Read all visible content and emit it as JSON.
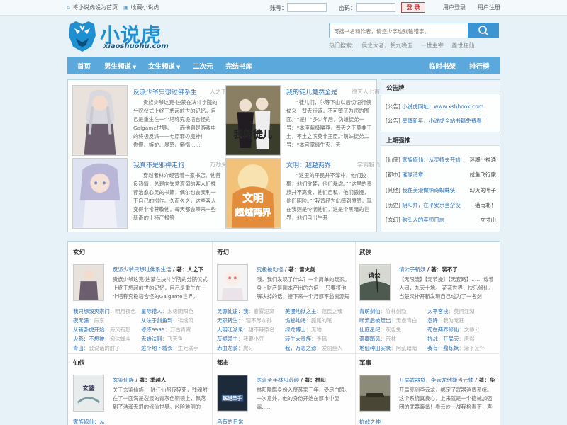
{
  "topbar": {
    "set_home": "将小说虎设为首页",
    "bookmark": "收藏小说虎",
    "account_label": "账号：",
    "password_label": "密码：",
    "login_button": "登 录",
    "user_login": "用户登录",
    "user_register": "用户注册"
  },
  "header": {
    "logo_text": "小说虎",
    "logo_sub": "xiaoshuohu.com",
    "search_placeholder": "可搜书名和作者，请您少字也别输错字。",
    "hot_label": "热门搜索:",
    "hot_terms": [
      "侯之大者，朝九晚五",
      "一世主宰",
      "盖世狂仙"
    ]
  },
  "nav": {
    "items": [
      "首页",
      "男生频道",
      "女生频道",
      "二次元",
      "完结书库"
    ],
    "right_items": [
      "临时书架",
      "排行榜"
    ]
  },
  "featured": [
    {
      "title": "反派少爷只想过佛系生",
      "author": "人之下",
      "desc": "贵族少爷这克·迪蒙在决斗学院的分院仪式上终于想起前世的记忆，自己是重生在一个塔称究极培合怪的Galgame世界。　　而他则是游戏中的终极反派——七原罪の魔神！　　傲慢、嫉妒、暴怒、懒惰……"
    },
    {
      "title": "我的徒儿竟然全是",
      "author": "徐天人七首",
      "desc": "“徒儿们，尔等下山以后切记行侠仗义，替天行道，不可堕了为师的围面。”“是！”多少年后，伪娘徒弟一号：“本座紫极魔尊，普天之下莫非王土，率土之滨莫非王臣。”萌妹徒弟二号：“本宫掌缘生灭，天"
    },
    {
      "title": "我真不是邪神走狗",
      "author": "万劫火",
      "desc": "穿越者林介经营着一家书店。他善良热情，总是向失意潦倒的客人们推荐治愈心灵的书籍，偶尔也会安利一下自己的拙作。久而久之，这些客人变得非常尊敬他，每天都会带来一些新奇的土特产报答"
    },
    {
      "title": "文明：超越两界",
      "author": "学霸毅飞",
      "desc": "“这里的平民并不淳朴，他们狡猾，他们贪婪，他们暴虐。”“这里的贵族并不高贵，他们自私，他们傲慢，他们阴险。”“我曾经为此感到愤怒，现在我则是怜悯他们，这是个黑暗的世界，他们自出生开"
    }
  ],
  "notice": {
    "title": "公告牌",
    "rows": [
      {
        "tag": "[公告]",
        "text": "小说虎网址：www.xshhook.com"
      },
      {
        "tag": "[公告]",
        "text": "星辉新年，小说虎全站书籍免费看！"
      }
    ]
  },
  "recommend": {
    "title": "上期强推",
    "rows": [
      {
        "tag": "[仙侠]",
        "book": "家族修仙：从灵植夫开始",
        "author": "迷糊小神通"
      },
      {
        "tag": "[都市]",
        "book": "璀璨诗章",
        "author": "咸鱼飞行家"
      },
      {
        "tag": "[其他]",
        "book": "我在美漫做惊奇蜘蛛侠",
        "author": "幻灭的叶子"
      },
      {
        "tag": "[历史]",
        "book": "阴阳师，在平安京当杂役",
        "author": "猫南北！"
      },
      {
        "tag": "[玄幻]",
        "book": "狗头人的巫师日志",
        "author": "立寸山"
      }
    ]
  },
  "categories": [
    {
      "name": "玄幻",
      "book": "反派少爷只想过佛系生活",
      "author_label": "/ 著：人之下",
      "desc": "贵族少爷这克·迪蒙在决斗学院的分院仪式上终于想起前世的记忆，自己是重生在一个塔称究极培合怪的Galgame世界。",
      "list": [
        [
          "我只想毁灭宗门",
          "明月夜色",
          "星际猎人",
          "太极阴阳色"
        ],
        [
          "夜无疆",
          "辰东",
          "从法于剑鱼到",
          "锦绣风"
        ],
        [
          "从斩卧虎开始",
          "海风有影",
          "修炼9999",
          "万古青霄"
        ],
        [
          "火影：不想被",
          "泡沫蜂斗",
          "无始法则",
          "飞天鱼"
        ],
        [
          "青山",
          "会说话的肘子",
          "这个地下城长",
          "生死满手"
        ]
      ]
    },
    {
      "name": "奇幻",
      "book": "究极被动怪",
      "author_label": "/ 著：雷火剑",
      "desc": "哦，我们发现了什么？一个简单的玩家。身上财产是副本产出的六倍！ 只要将他解决掉的话，接下来一个月都不愁资源短",
      "list": [
        [
          "灵源仙途：我",
          "春雾泥窝",
          "美漫地狱之主",
          "范氏之魂"
        ],
        [
          "无职转生：",
          "理不尽な孙",
          "诡秘地海",
          "狐尾的笔"
        ],
        [
          "大明江湖录",
          "甜不辣原名",
          "绿龙博士",
          "无物"
        ],
        [
          "灰烬领主",
          "我要小豆",
          "转生大贵族",
          "予稿"
        ],
        [
          "赤血龙骑",
          "虎牙",
          "我，万恶之源",
          "爱丽丝人"
        ]
      ]
    },
    {
      "name": "武侠",
      "book": "请公子斩妖",
      "author_label": "/ 著：裴不了",
      "desc": "【无限流】【无节操】【无套路】…… 载着人间，九天十地。 花花世界，快乐修仙。 当楚梁神开新发现自己成为了一名剑",
      "list": [
        [
          "青萌剑仙",
          "竹林剑隐",
          "太平客栈",
          "莫问江湖"
        ],
        [
          "断流后被赶出",
          "无虑青白",
          "忽降",
          "我为宠狂"
        ],
        [
          "仙庭星纪",
          "灰色兔",
          "苟在两界修仙",
          "文静公"
        ],
        [
          "漫卿踏风",
          "荒林",
          "抗战：开局天",
          "唐然"
        ],
        [
          "地仙种田实录",
          "阿乱暗暗",
          "我有一鼎炼妖",
          "渐下茫怀"
        ]
      ]
    },
    {
      "name": "仙侠",
      "book": "玄鉴仙族",
      "author_label": "/ 著：季越人",
      "desc": "关于玄鉴仙族： 陆江仙熬夜猝死，残魂附在了一面满是裂痕的青灰色铜镜上，飘落到了浩瀚无垠的修仙世界。凶险难测的",
      "bottom": "家族修仙：从"
    },
    {
      "name": "都市",
      "book": "医道圣手林阳苏颜",
      "author_label": "/ 著：林阳",
      "desc": "林阳隐瞒身份入赘苏家三年，受尽白眼。一次意外，他的身份开始在都市中显露……",
      "bottom": "乌有的日常"
    },
    {
      "name": "军事",
      "book": "开局武器贷，李云龙他能当元帅",
      "author_label": "/ 著：华",
      "desc": "开局亮剑李云龙，绑定了武器消费系统。 这个系统真良心，上来就是一个德械加强团的武器装备！看云岭一战我检素下，声",
      "bottom": "抗战之神"
    }
  ]
}
